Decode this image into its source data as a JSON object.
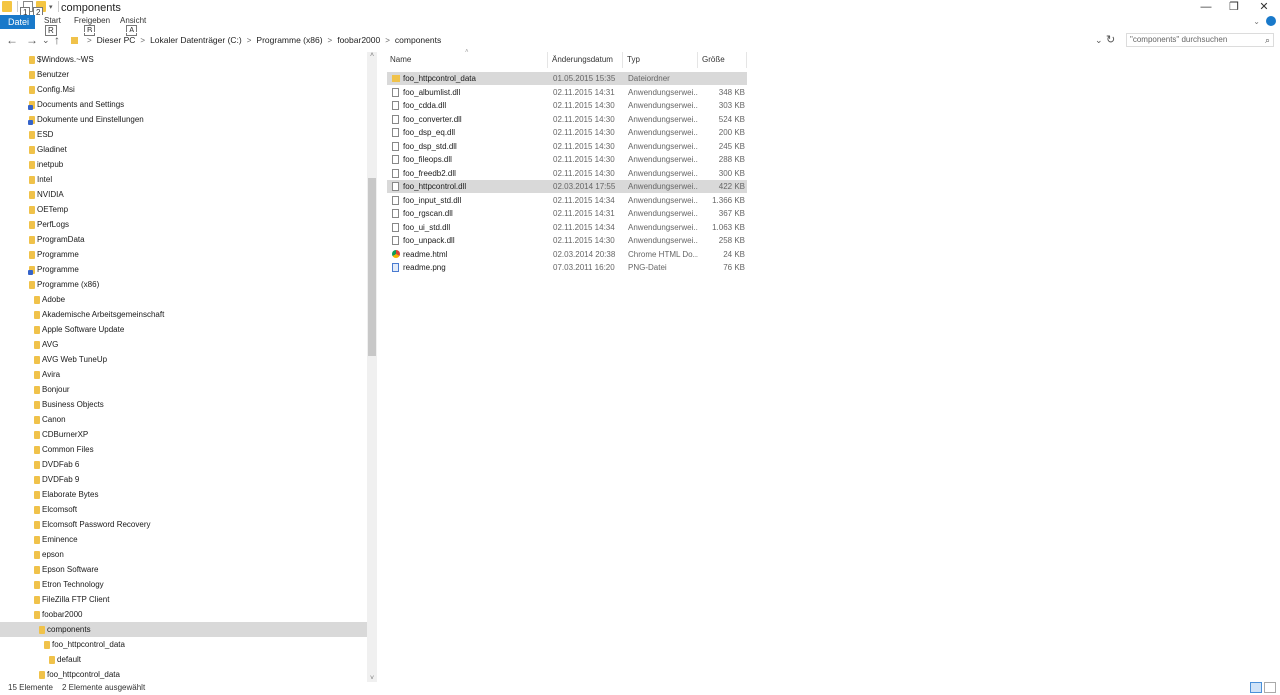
{
  "window": {
    "title": "components",
    "controls": [
      "—",
      "❐",
      "✕"
    ],
    "keytips": [
      "1",
      "2"
    ]
  },
  "ribbon": {
    "file_tab": "Datei",
    "tabs": [
      "Start",
      "Freigeben",
      "Ansicht"
    ],
    "keytips": [
      "R",
      "B",
      "A"
    ]
  },
  "address": {
    "back": "←",
    "forward": "→",
    "recent": "⌄",
    "up": "↑",
    "crumbs": [
      "Dieser PC",
      "Lokaler Datenträger (C:)",
      "Programme (x86)",
      "foobar2000",
      "components"
    ],
    "separator": ">",
    "refresh": "↻",
    "dropdown": "⌄",
    "search_placeholder": "\"components\" durchsuchen",
    "search_icon": "⌕"
  },
  "tree": {
    "items": [
      {
        "label": "$Windows.~WS",
        "level": 0,
        "link": false
      },
      {
        "label": "Benutzer",
        "level": 0,
        "link": false
      },
      {
        "label": "Config.Msi",
        "level": 0,
        "link": false
      },
      {
        "label": "Documents and Settings",
        "level": 0,
        "link": true
      },
      {
        "label": "Dokumente und Einstellungen",
        "level": 0,
        "link": true
      },
      {
        "label": "ESD",
        "level": 0,
        "link": false
      },
      {
        "label": "Gladinet",
        "level": 0,
        "link": false
      },
      {
        "label": "inetpub",
        "level": 0,
        "link": false
      },
      {
        "label": "Intel",
        "level": 0,
        "link": false
      },
      {
        "label": "NVIDIA",
        "level": 0,
        "link": false
      },
      {
        "label": "OETemp",
        "level": 0,
        "link": false
      },
      {
        "label": "PerfLogs",
        "level": 0,
        "link": false
      },
      {
        "label": "ProgramData",
        "level": 0,
        "link": false
      },
      {
        "label": "Programme",
        "level": 0,
        "link": false
      },
      {
        "label": "Programme",
        "level": 0,
        "link": true
      },
      {
        "label": "Programme (x86)",
        "level": 0,
        "link": false
      },
      {
        "label": "Adobe",
        "level": 1,
        "link": false
      },
      {
        "label": "Akademische Arbeitsgemeinschaft",
        "level": 1,
        "link": false
      },
      {
        "label": "Apple Software Update",
        "level": 1,
        "link": false
      },
      {
        "label": "AVG",
        "level": 1,
        "link": false
      },
      {
        "label": "AVG Web TuneUp",
        "level": 1,
        "link": false
      },
      {
        "label": "Avira",
        "level": 1,
        "link": false
      },
      {
        "label": "Bonjour",
        "level": 1,
        "link": false
      },
      {
        "label": "Business Objects",
        "level": 1,
        "link": false
      },
      {
        "label": "Canon",
        "level": 1,
        "link": false
      },
      {
        "label": "CDBurnerXP",
        "level": 1,
        "link": false
      },
      {
        "label": "Common Files",
        "level": 1,
        "link": false
      },
      {
        "label": "DVDFab 6",
        "level": 1,
        "link": false
      },
      {
        "label": "DVDFab 9",
        "level": 1,
        "link": false
      },
      {
        "label": "Elaborate Bytes",
        "level": 1,
        "link": false
      },
      {
        "label": "Elcomsoft",
        "level": 1,
        "link": false
      },
      {
        "label": "Elcomsoft Password Recovery",
        "level": 1,
        "link": false
      },
      {
        "label": "Eminence",
        "level": 1,
        "link": false
      },
      {
        "label": "epson",
        "level": 1,
        "link": false
      },
      {
        "label": "Epson Software",
        "level": 1,
        "link": false
      },
      {
        "label": "Etron Technology",
        "level": 1,
        "link": false
      },
      {
        "label": "FileZilla FTP Client",
        "level": 1,
        "link": false
      },
      {
        "label": "foobar2000",
        "level": 1,
        "link": false
      },
      {
        "label": "components",
        "level": 2,
        "link": false,
        "selected": true
      },
      {
        "label": "foo_httpcontrol_data",
        "level": 3,
        "link": false
      },
      {
        "label": "default",
        "level": 4,
        "link": false
      },
      {
        "label": "foo_httpcontrol_data",
        "level": 2,
        "link": false
      }
    ],
    "scroll_up": "˄",
    "scroll_down": "˅"
  },
  "filelist": {
    "columns": [
      "Name",
      "Änderungsdatum",
      "Typ",
      "Größe"
    ],
    "sort_indicator": "˄",
    "rows": [
      {
        "name": "foo_httpcontrol_data",
        "date": "01.05.2015 15:35",
        "type": "Dateiordner",
        "size": "",
        "icon": "folder",
        "selected": true
      },
      {
        "name": "foo_albumlist.dll",
        "date": "02.11.2015 14:31",
        "type": "Anwendungserwei...",
        "size": "348 KB",
        "icon": "dll"
      },
      {
        "name": "foo_cdda.dll",
        "date": "02.11.2015 14:30",
        "type": "Anwendungserwei...",
        "size": "303 KB",
        "icon": "dll"
      },
      {
        "name": "foo_converter.dll",
        "date": "02.11.2015 14:30",
        "type": "Anwendungserwei...",
        "size": "524 KB",
        "icon": "dll"
      },
      {
        "name": "foo_dsp_eq.dll",
        "date": "02.11.2015 14:30",
        "type": "Anwendungserwei...",
        "size": "200 KB",
        "icon": "dll"
      },
      {
        "name": "foo_dsp_std.dll",
        "date": "02.11.2015 14:30",
        "type": "Anwendungserwei...",
        "size": "245 KB",
        "icon": "dll"
      },
      {
        "name": "foo_fileops.dll",
        "date": "02.11.2015 14:30",
        "type": "Anwendungserwei...",
        "size": "288 KB",
        "icon": "dll"
      },
      {
        "name": "foo_freedb2.dll",
        "date": "02.11.2015 14:30",
        "type": "Anwendungserwei...",
        "size": "300 KB",
        "icon": "dll"
      },
      {
        "name": "foo_httpcontrol.dll",
        "date": "02.03.2014 17:55",
        "type": "Anwendungserwei...",
        "size": "422 KB",
        "icon": "dll",
        "selected": true
      },
      {
        "name": "foo_input_std.dll",
        "date": "02.11.2015 14:34",
        "type": "Anwendungserwei...",
        "size": "1.366 KB",
        "icon": "dll"
      },
      {
        "name": "foo_rgscan.dll",
        "date": "02.11.2015 14:31",
        "type": "Anwendungserwei...",
        "size": "367 KB",
        "icon": "dll"
      },
      {
        "name": "foo_ui_std.dll",
        "date": "02.11.2015 14:34",
        "type": "Anwendungserwei...",
        "size": "1.063 KB",
        "icon": "dll"
      },
      {
        "name": "foo_unpack.dll",
        "date": "02.11.2015 14:30",
        "type": "Anwendungserwei...",
        "size": "258 KB",
        "icon": "dll"
      },
      {
        "name": "readme.html",
        "date": "02.03.2014 20:38",
        "type": "Chrome HTML Do...",
        "size": "24 KB",
        "icon": "chrome"
      },
      {
        "name": "readme.png",
        "date": "07.03.2011 16:20",
        "type": "PNG-Datei",
        "size": "76 KB",
        "icon": "png"
      }
    ]
  },
  "status": {
    "count": "15 Elemente",
    "selection": "2 Elemente ausgewählt"
  },
  "colors": {
    "accent": "#1979ca",
    "selection": "#d9d9d9",
    "folder": "#f0c24a"
  }
}
